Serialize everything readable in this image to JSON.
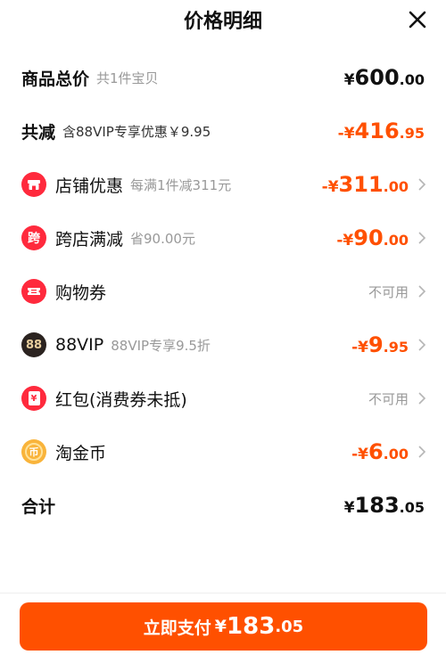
{
  "header": {
    "title": "价格明细",
    "close_icon": "close-icon"
  },
  "total_goods": {
    "label": "商品总价",
    "sub": "共1件宝贝",
    "sym": "¥",
    "int": "600",
    "dec": ".00"
  },
  "total_discount": {
    "label": "共减",
    "sub": "含88VIP专享优惠￥9.95",
    "sym": "-¥",
    "int": "416",
    "dec": ".95"
  },
  "discounts": [
    {
      "name": "店铺优惠",
      "sub": "每满1件减311元",
      "icon": "shop-icon",
      "icon_text": "",
      "sym": "-¥",
      "int": "311",
      "dec": ".00",
      "status": ""
    },
    {
      "name": "跨店满减",
      "sub": "省90.00元",
      "icon": "cross-store-icon",
      "icon_text": "跨",
      "sym": "-¥",
      "int": "90",
      "dec": ".00",
      "status": ""
    },
    {
      "name": "购物券",
      "sub": "",
      "icon": "coupon-icon",
      "icon_text": "",
      "sym": "",
      "int": "",
      "dec": "",
      "status": "不可用"
    },
    {
      "name": "88VIP",
      "sub": "88VIP专享9.5折",
      "icon": "vip88-icon",
      "icon_text": "88",
      "sym": "-¥",
      "int": "9",
      "dec": ".95",
      "status": ""
    },
    {
      "name": "红包(消费券未抵)",
      "sub": "",
      "icon": "red-envelope-icon",
      "icon_text": "¥",
      "sym": "",
      "int": "",
      "dec": "",
      "status": "不可用"
    },
    {
      "name": "淘金币",
      "sub": "",
      "icon": "gold-coin-icon",
      "icon_text": "币",
      "sym": "-¥",
      "int": "6",
      "dec": ".00",
      "status": ""
    }
  ],
  "total": {
    "label": "合计",
    "sym": "¥",
    "int": "183",
    "dec": ".05"
  },
  "pay_button": {
    "label": "立即支付",
    "sym": "¥",
    "int": "183",
    "dec": ".05"
  },
  "colors": {
    "accent": "#ff5000",
    "icon_red": "#ff2a3d",
    "vip_dark": "#2b2320",
    "coin_gold": "#f9b43b",
    "muted": "#999999"
  }
}
